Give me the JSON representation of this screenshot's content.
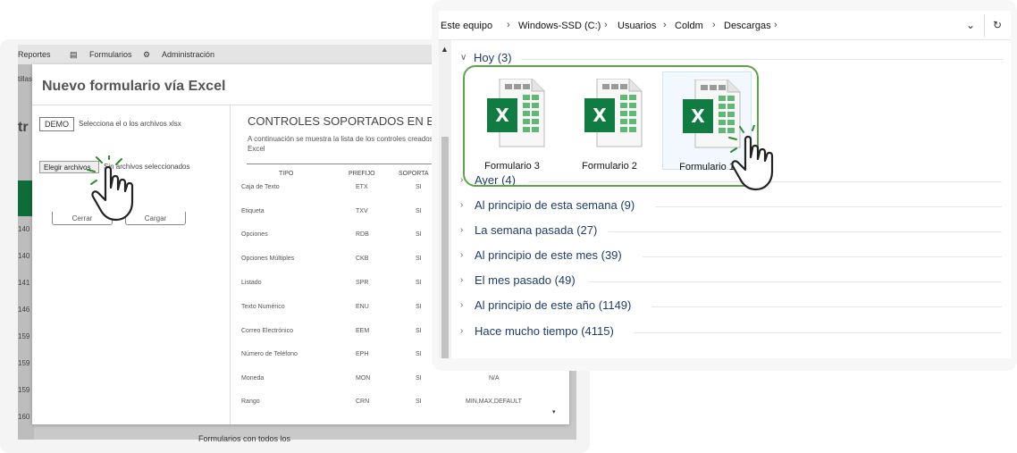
{
  "back_app": {
    "nav": [
      "Reportes",
      "Formularios",
      "Administración"
    ],
    "left_labels": [
      "tillas",
      "tr",
      "140",
      "140",
      "141",
      "146",
      "159",
      "159",
      "159",
      "160"
    ],
    "bottom_text": "Formularios con todos los"
  },
  "modal": {
    "title": "Nuevo formulario vía Excel",
    "demo_label": "DEMO",
    "select_text": "Selecciona el o los archivos xlsx",
    "choose_file_label": "Elegir archivos",
    "no_file_text": "Sin archivos seleccionados",
    "close_label": "Cerrar",
    "load_label": "Cargar",
    "controls_title": "CONTROLES SOPORTADOS EN EXC",
    "controls_desc": "A continuación se muestra la lista de los controles creados en Excel",
    "columns": [
      "TIPO",
      "PREFIJO",
      "SOPORTA"
    ],
    "rows": [
      {
        "tipo": "Caja de Texto",
        "prefijo": "ETX",
        "soporta": "SI",
        "extra": ""
      },
      {
        "tipo": "Etiqueta",
        "prefijo": "TXV",
        "soporta": "SI",
        "extra": ""
      },
      {
        "tipo": "Opciones",
        "prefijo": "RDB",
        "soporta": "SI",
        "extra": ""
      },
      {
        "tipo": "Opciones Múltiples",
        "prefijo": "CKB",
        "soporta": "SI",
        "extra": ""
      },
      {
        "tipo": "Listado",
        "prefijo": "SPR",
        "soporta": "SI",
        "extra": ""
      },
      {
        "tipo": "Texto Numérico",
        "prefijo": "ENU",
        "soporta": "SI",
        "extra": ""
      },
      {
        "tipo": "Correo Electrónico",
        "prefijo": "EEM",
        "soporta": "SI",
        "extra": ""
      },
      {
        "tipo": "Número de Teléfono",
        "prefijo": "EPH",
        "soporta": "SI",
        "extra": ""
      },
      {
        "tipo": "Moneda",
        "prefijo": "MON",
        "soporta": "SI",
        "extra": "N/A"
      },
      {
        "tipo": "Rango",
        "prefijo": "CRN",
        "soporta": "SI",
        "extra": "MIN,MAX,DEFAULT"
      }
    ]
  },
  "explorer": {
    "breadcrumb": [
      "Este equipo",
      "Windows-SSD (C:)",
      "Usuarios",
      "Coldm",
      "Descargas"
    ],
    "groups": [
      {
        "label": "Hoy (3)",
        "expanded": true
      },
      {
        "label": "Ayer (4)",
        "expanded": false
      },
      {
        "label": "Al principio de esta semana (9)",
        "expanded": false
      },
      {
        "label": "La semana pasada (27)",
        "expanded": false
      },
      {
        "label": "Al principio de este mes (39)",
        "expanded": false
      },
      {
        "label": "El mes pasado (49)",
        "expanded": false
      },
      {
        "label": "Al principio de este año (1149)",
        "expanded": false
      },
      {
        "label": "Hace mucho tiempo (4115)",
        "expanded": false
      }
    ],
    "files": [
      {
        "name": "Formulario 3",
        "selected": false
      },
      {
        "name": "Formulario 2",
        "selected": false
      },
      {
        "name": "Formulario 1",
        "selected": true
      }
    ]
  },
  "colors": {
    "excel_green": "#107c41",
    "highlight_green": "#5aa744",
    "group_text": "#1e3d6b"
  }
}
